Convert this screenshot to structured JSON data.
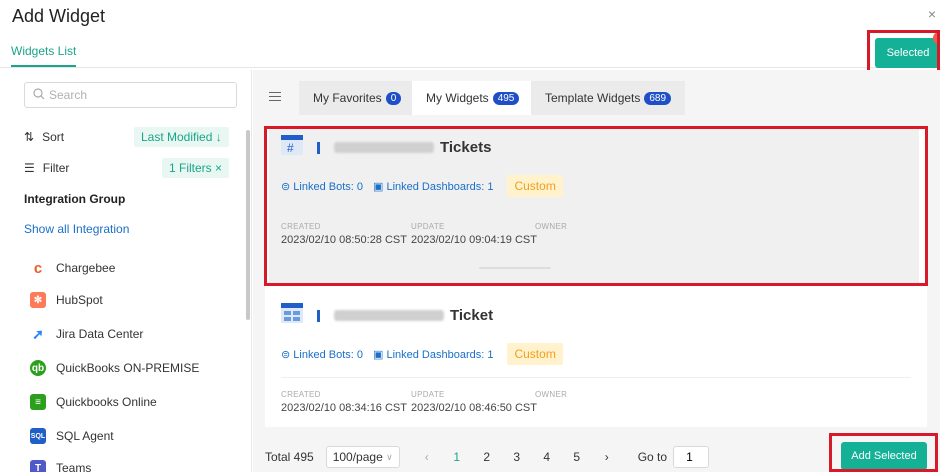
{
  "dialog": {
    "title": "Add Widget",
    "close_glyph": "×"
  },
  "tabs": {
    "widgets_list": "Widgets List"
  },
  "selected_button": {
    "label": "Selected"
  },
  "left": {
    "search_placeholder": "Search",
    "sort_label": "Sort",
    "sort_value": "Last Modified ↓",
    "filter_label": "Filter",
    "filter_value": "1 Filters ×",
    "group_title": "Integration Group",
    "show_all": "Show all Integration",
    "integrations": [
      {
        "label": "Chargebee",
        "icon": "chargebee-icon",
        "color": "#f05a28"
      },
      {
        "label": "HubSpot",
        "icon": "hubspot-icon",
        "color": "#ff7a59"
      },
      {
        "label": "Jira Data Center",
        "icon": "jira-icon",
        "color": "#2684ff"
      },
      {
        "label": "QuickBooks ON-PREMISE",
        "icon": "quickbooks-icon",
        "color": "#2ca01c"
      },
      {
        "label": "Quickbooks Online",
        "icon": "quickbooks-online-icon",
        "color": "#2ca01c"
      },
      {
        "label": "SQL Agent",
        "icon": "sql-agent-icon",
        "color": "#1f5fc7"
      },
      {
        "label": "Teams",
        "icon": "teams-icon",
        "color": "#5059c9"
      }
    ]
  },
  "right": {
    "tabs": [
      {
        "label": "My Favorites",
        "count": "0"
      },
      {
        "label": "My Widgets",
        "count": "495"
      },
      {
        "label": "Template Widgets",
        "count": "689"
      }
    ],
    "cards": [
      {
        "name": "Tickets",
        "linked_bots": "Linked Bots: 0",
        "linked_dashboards": "Linked Dashboards: 1",
        "tag": "Custom",
        "created_label": "CREATED",
        "created": "2023/02/10 08:50:28 CST",
        "update_label": "UPDATE",
        "update": "2023/02/10 09:04:19 CST",
        "owner_label": "OWNER"
      },
      {
        "name": "Ticket",
        "linked_bots": "Linked Bots: 0",
        "linked_dashboards": "Linked Dashboards: 1",
        "tag": "Custom",
        "created_label": "CREATED",
        "created": "2023/02/10 08:34:16 CST",
        "update_label": "UPDATE",
        "update": "2023/02/10 08:46:50 CST",
        "owner_label": "OWNER"
      }
    ],
    "pager": {
      "total": "Total 495",
      "page_size": "100/page",
      "prev": "‹",
      "pages": [
        "1",
        "2",
        "3",
        "4",
        "5"
      ],
      "next": "›",
      "goto_label": "Go to",
      "goto_value": "1"
    }
  },
  "add_selected": {
    "label": "Add Selected"
  },
  "colors": {
    "accent": "#15b197",
    "highlight": "#d7192a",
    "badge": "#1f4fc7"
  }
}
